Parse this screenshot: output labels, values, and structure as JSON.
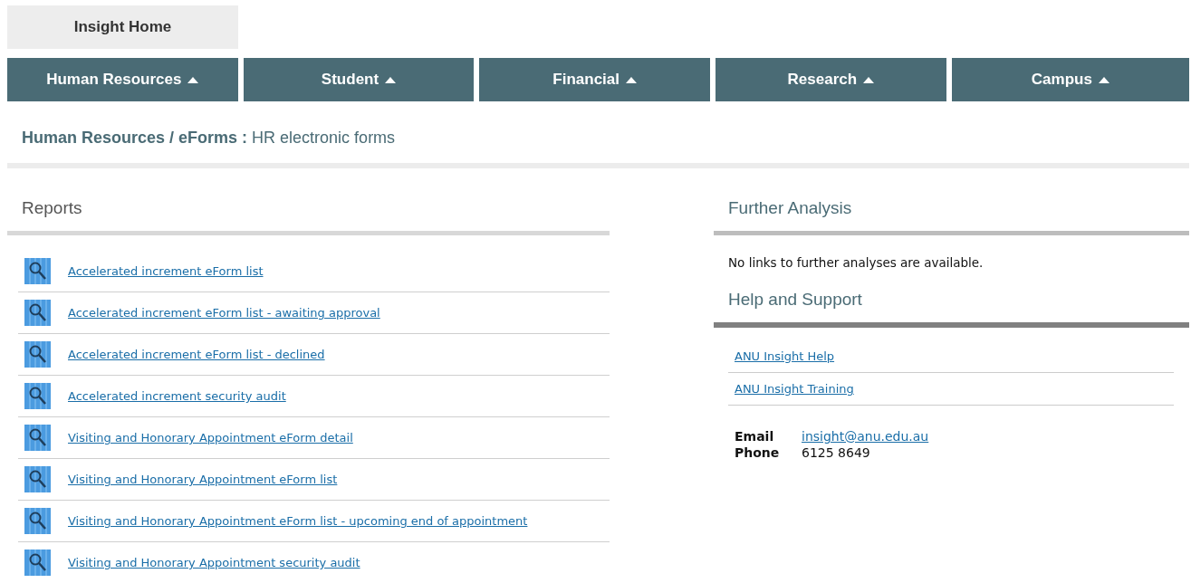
{
  "home_button": {
    "label": "Insight Home"
  },
  "nav_tabs": [
    {
      "label": "Human Resources"
    },
    {
      "label": "Student"
    },
    {
      "label": "Financial"
    },
    {
      "label": "Research"
    },
    {
      "label": "Campus"
    }
  ],
  "breadcrumb": "**Human Resources / eForms :** HR electronic forms",
  "reports": {
    "title": "Reports",
    "items": [
      {
        "label": "Accelerated increment eForm list"
      },
      {
        "label": "Accelerated increment eForm list - awaiting approval"
      },
      {
        "label": "Accelerated increment eForm list - declined"
      },
      {
        "label": "Accelerated increment security audit"
      },
      {
        "label": "Visiting and Honorary Appointment eForm detail"
      },
      {
        "label": "Visiting and Honorary Appointment eForm list"
      },
      {
        "label": "Visiting and Honorary Appointment eForm list - upcoming end of appointment"
      },
      {
        "label": "Visiting and Honorary Appointment security audit"
      }
    ]
  },
  "further_analysis": {
    "title": "Further Analysis",
    "message": "No links to further analyses are available."
  },
  "help": {
    "title": "Help and Support",
    "links": [
      {
        "label": "ANU Insight Help"
      },
      {
        "label": "ANU Insight Training"
      }
    ],
    "contacts": [
      {
        "label": "Email",
        "value": "insight@anu.edu.au",
        "kind": "link"
      },
      {
        "label": "Phone",
        "value": "6125 8649",
        "kind": "text"
      }
    ]
  }
}
